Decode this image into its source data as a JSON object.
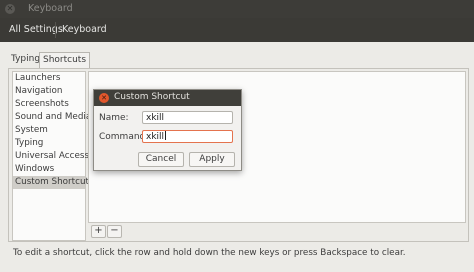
{
  "window": {
    "title": "Keyboard"
  },
  "toolbar": {
    "all_settings": "All Settings",
    "keyboard": "Keyboard"
  },
  "tabs": [
    {
      "label": "Typing"
    },
    {
      "label": "Shortcuts"
    }
  ],
  "sidebar": {
    "items": [
      {
        "label": "Launchers"
      },
      {
        "label": "Navigation"
      },
      {
        "label": "Screenshots"
      },
      {
        "label": "Sound and Media"
      },
      {
        "label": "System"
      },
      {
        "label": "Typing"
      },
      {
        "label": "Universal Access"
      },
      {
        "label": "Windows"
      },
      {
        "label": "Custom Shortcuts"
      }
    ]
  },
  "buttons": {
    "add": "+",
    "remove": "−"
  },
  "hint": "To edit a shortcut, click the row and hold down the new keys or press Backspace to clear.",
  "dialog": {
    "title": "Custom Shortcut",
    "name_label": "Name:",
    "name_value": "xkill",
    "command_label": "Command:",
    "command_value": "xkill",
    "cancel": "Cancel",
    "apply": "Apply"
  },
  "colors": {
    "accent": "#e2572c",
    "focus_border": "#e4734e",
    "titlebar": "#3d3c38"
  }
}
